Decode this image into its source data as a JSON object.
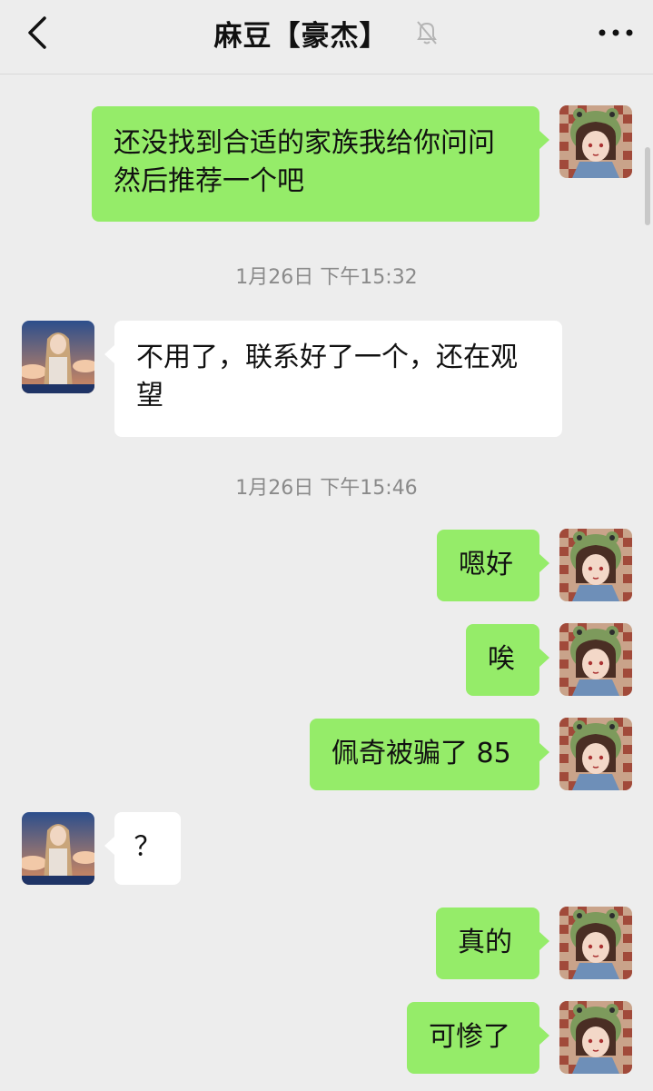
{
  "header": {
    "title": "麻豆【豪杰】",
    "back_icon": "chevron-left-icon",
    "mute_icon": "bell-off-icon",
    "more_icon": "more-horizontal-icon"
  },
  "colors": {
    "background": "#ededed",
    "outgoing_bubble": "#95ec69",
    "incoming_bubble": "#ffffff",
    "timestamp": "#8a8a8a"
  },
  "messages": [
    {
      "sender": "me",
      "text": "还没找到合适的家族我给你问问然后推荐一个吧"
    },
    {
      "timestamp": "1月26日  下午15:32"
    },
    {
      "sender": "other",
      "text": "不用了，联系好了一个，还在观望"
    },
    {
      "timestamp": "1月26日  下午15:46"
    },
    {
      "sender": "me",
      "text": "嗯好"
    },
    {
      "sender": "me",
      "text": "唉"
    },
    {
      "sender": "me",
      "text": "佩奇被骗了 85"
    },
    {
      "sender": "other",
      "text": "？"
    },
    {
      "sender": "me",
      "text": "真的"
    },
    {
      "sender": "me",
      "text": "可惨了"
    }
  ]
}
